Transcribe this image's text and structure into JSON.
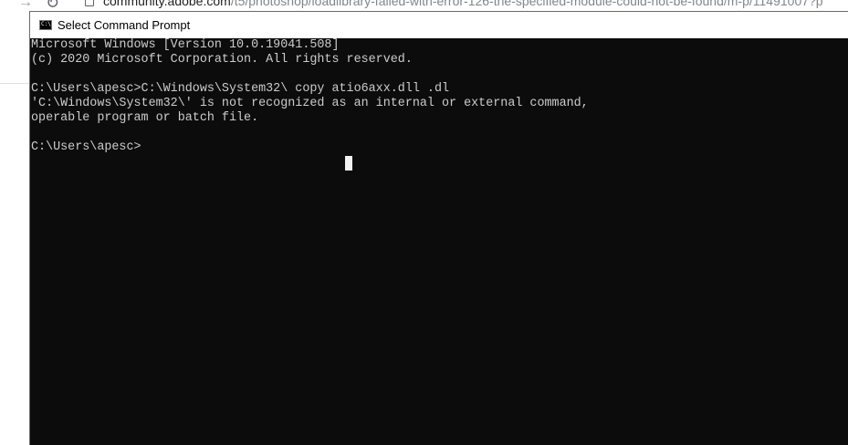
{
  "browser": {
    "forward_glyph": "→",
    "reload_glyph": "↻",
    "url_host": "community.adobe.com",
    "url_path": "/t5/photoshop/loadlibrary-failed-with-error-126-the-specified-module-could-not-be-found/m-p/11491007?p"
  },
  "window": {
    "title": "Select Command Prompt",
    "icon": "cmd-icon",
    "icon_glyph": "C:\\"
  },
  "console": {
    "lines": [
      "Microsoft Windows [Version 10.0.19041.508]",
      "(c) 2020 Microsoft Corporation. All rights reserved.",
      "",
      "C:\\Users\\apesc>C:\\Windows\\System32\\ copy atio6axx.dll .dl",
      "'C:\\Windows\\System32\\' is not recognized as an internal or external command,",
      "operable program or batch file.",
      "",
      "C:\\Users\\apesc>"
    ]
  },
  "colors": {
    "console_bg": "#0c0c0c",
    "console_text": "#cccccc",
    "titlebar_bg": "#ffffff"
  }
}
